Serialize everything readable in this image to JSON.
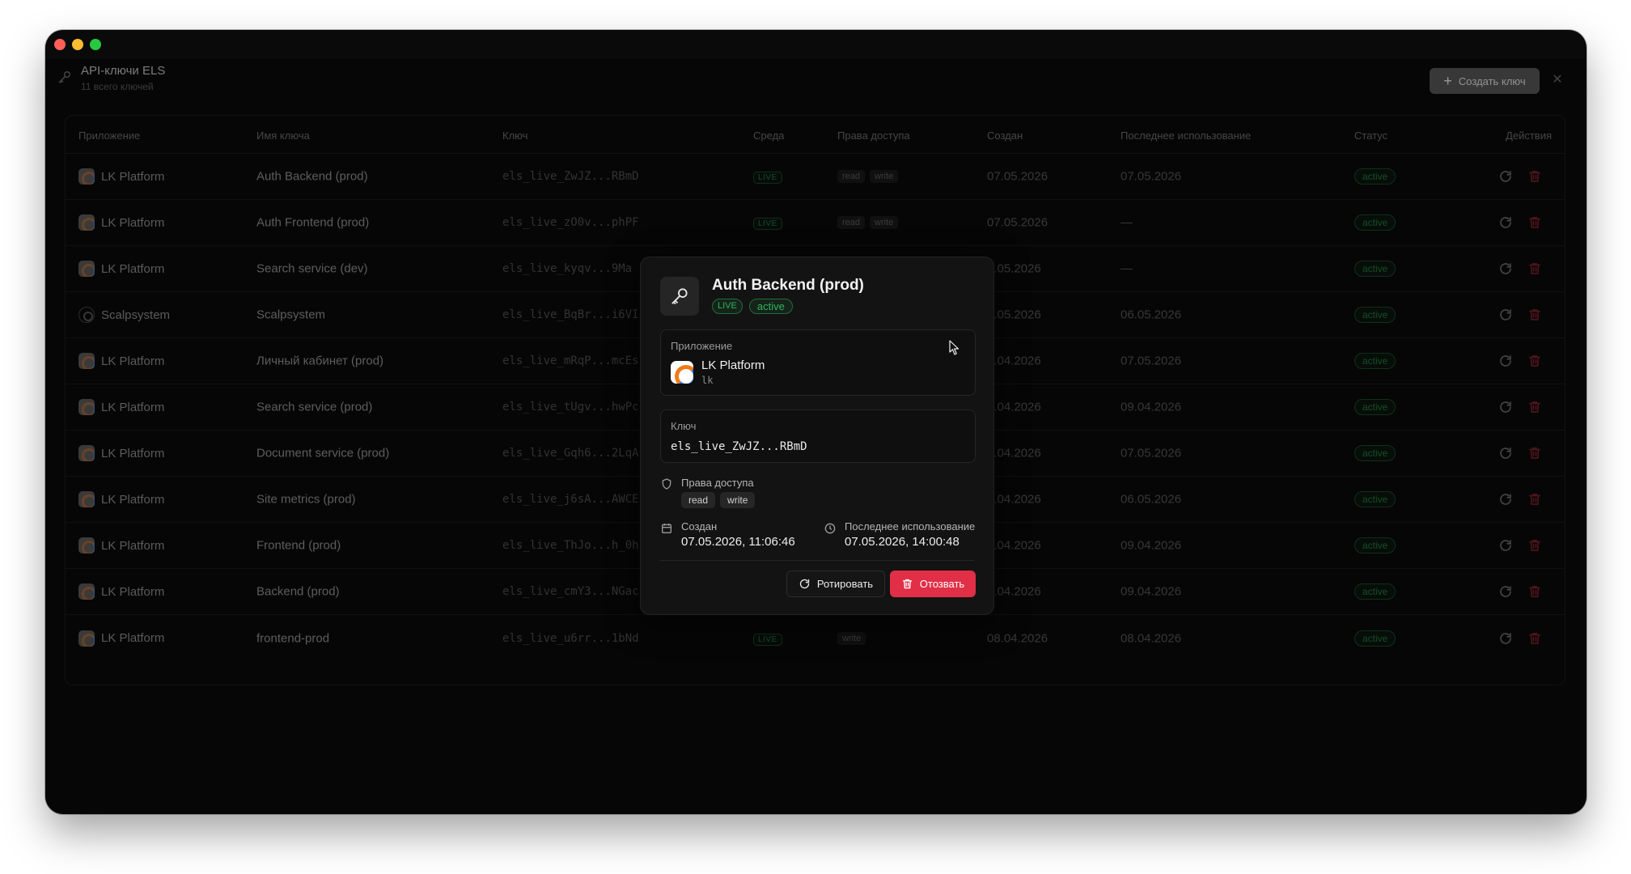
{
  "header": {
    "title": "API-ключи ELS",
    "subtitle": "11 всего ключей",
    "create_label": "Создать ключ"
  },
  "columns": {
    "app": "Приложение",
    "name": "Имя ключа",
    "key": "Ключ",
    "env": "Среда",
    "perms": "Права доступа",
    "created": "Создан",
    "last_used": "Последнее использование",
    "status": "Статус",
    "actions": "Действия"
  },
  "rows": [
    {
      "app": "LK Platform",
      "name": "Auth Backend (prod)",
      "key": "els_live_ZwJZ...RBmD",
      "env": "LIVE",
      "perms": [
        "read",
        "write"
      ],
      "created": "07.05.2026",
      "last_used": "07.05.2026",
      "status": "active"
    },
    {
      "app": "LK Platform",
      "name": "Auth Frontend (prod)",
      "key": "els_live_zO0v...phPF",
      "env": "LIVE",
      "perms": [
        "read",
        "write"
      ],
      "created": "07.05.2026",
      "last_used": "—",
      "status": "active"
    },
    {
      "app": "LK Platform",
      "name": "Search service (dev)",
      "key": "els_live_kyqv...9Ma",
      "env": "",
      "perms": [],
      "created": "6.05.2026",
      "last_used": "—",
      "status": "active"
    },
    {
      "app": "Scalpsystem",
      "name": "Scalpsystem",
      "key": "els_live_BqBr...i6VI",
      "env": "",
      "perms": [],
      "created": "5.05.2026",
      "last_used": "06.05.2026",
      "status": "active"
    },
    {
      "app": "LK Platform",
      "name": "Личный кабинет (prod)",
      "key": "els_live_mRqP...mcEs",
      "env": "",
      "perms": [],
      "created": "9.04.2026",
      "last_used": "07.05.2026",
      "status": "active"
    },
    {
      "app": "LK Platform",
      "name": "Search service (prod)",
      "key": "els_live_tUgv...hwPc",
      "env": "",
      "perms": [],
      "created": "9.04.2026",
      "last_used": "09.04.2026",
      "status": "active"
    },
    {
      "app": "LK Platform",
      "name": "Document service (prod)",
      "key": "els_live_Gqh6...2LqA",
      "env": "",
      "perms": [],
      "created": "9.04.2026",
      "last_used": "07.05.2026",
      "status": "active"
    },
    {
      "app": "LK Platform",
      "name": "Site metrics (prod)",
      "key": "els_live_j6sA...AWCE",
      "env": "",
      "perms": [],
      "created": "9.04.2026",
      "last_used": "06.05.2026",
      "status": "active"
    },
    {
      "app": "LK Platform",
      "name": "Frontend (prod)",
      "key": "els_live_ThJo...h_0h",
      "env": "",
      "perms": [],
      "created": "9.04.2026",
      "last_used": "09.04.2026",
      "status": "active"
    },
    {
      "app": "LK Platform",
      "name": "Backend (prod)",
      "key": "els_live_cmY3...NGac",
      "env": "",
      "perms": [],
      "created": "9.04.2026",
      "last_used": "09.04.2026",
      "status": "active"
    },
    {
      "app": "LK Platform",
      "name": "frontend-prod",
      "key": "els_live_u6rr...1bNd",
      "env": "LIVE",
      "perms": [
        "write"
      ],
      "created": "08.04.2026",
      "last_used": "08.04.2026",
      "status": "active"
    }
  ],
  "modal": {
    "title": "Auth Backend (prod)",
    "env_badge": "LIVE",
    "status_badge": "active",
    "app_label": "Приложение",
    "app_name": "LK Platform",
    "app_slug": "lk",
    "key_label": "Ключ",
    "key_value": "els_live_ZwJZ...RBmD",
    "perms_label": "Права доступа",
    "perms": [
      "read",
      "write"
    ],
    "created_label": "Создан",
    "created_value": "07.05.2026, 11:06:46",
    "last_used_label": "Последнее использование",
    "last_used_value": "07.05.2026, 14:00:48",
    "rotate_label": "Ротировать",
    "revoke_label": "Отозвать"
  },
  "colors": {
    "accent_red": "#e02f47",
    "status_green": "#2fb359",
    "background": "#0a0a0a"
  },
  "icons": {
    "header": "key-icon",
    "row_rotate": "refresh-icon",
    "row_delete": "trash-icon",
    "modal_header": "key-icon",
    "perms": "shield-icon",
    "created": "calendar-icon",
    "last_used": "clock-icon"
  }
}
